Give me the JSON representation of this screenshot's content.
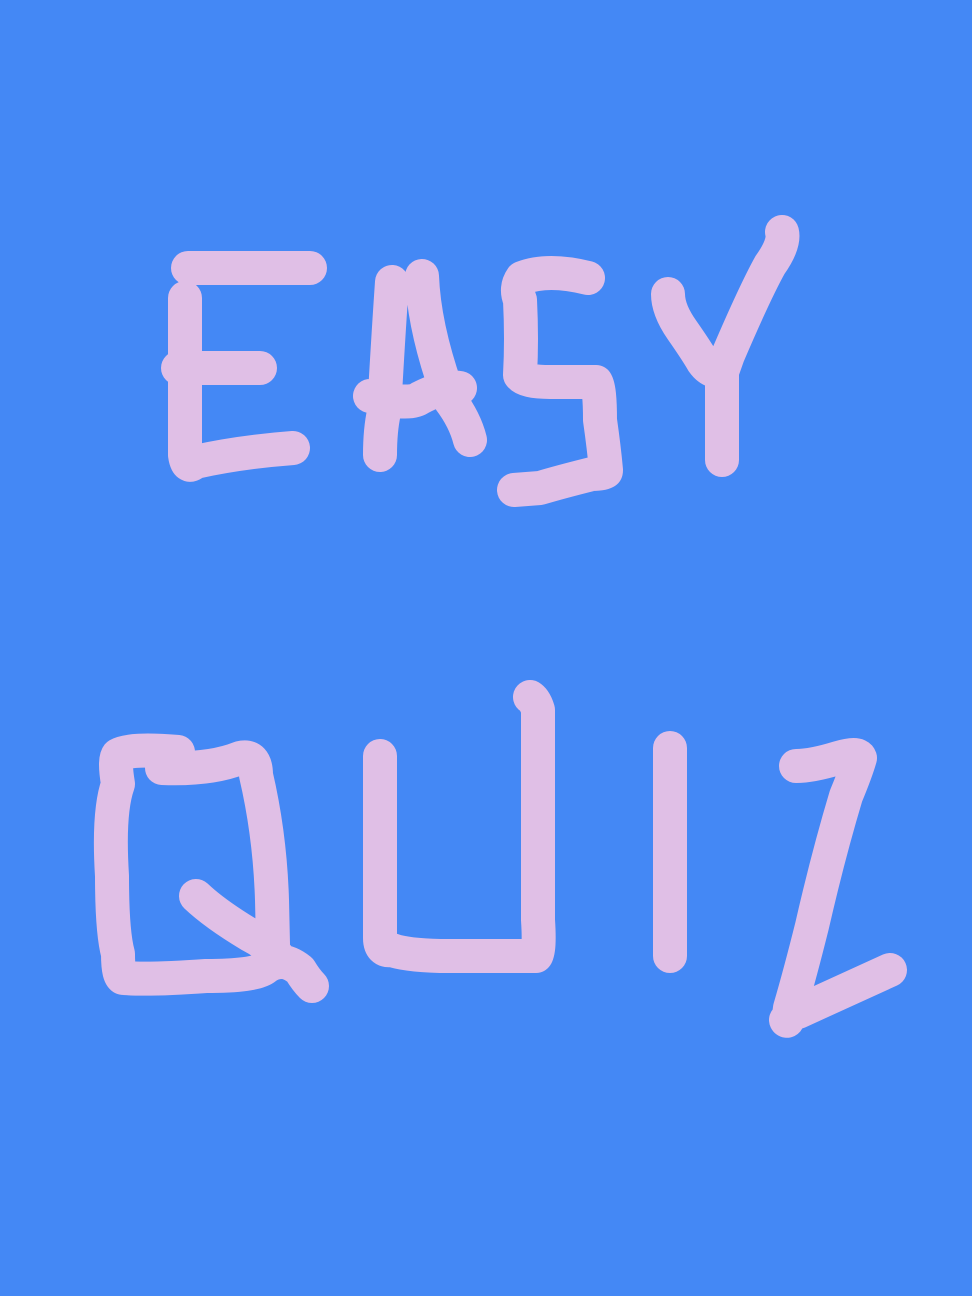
{
  "drawing": {
    "line1": "EASY",
    "line2": "QUIZ",
    "background_color": "#4488f5",
    "ink_color": "#e0bfe6"
  }
}
